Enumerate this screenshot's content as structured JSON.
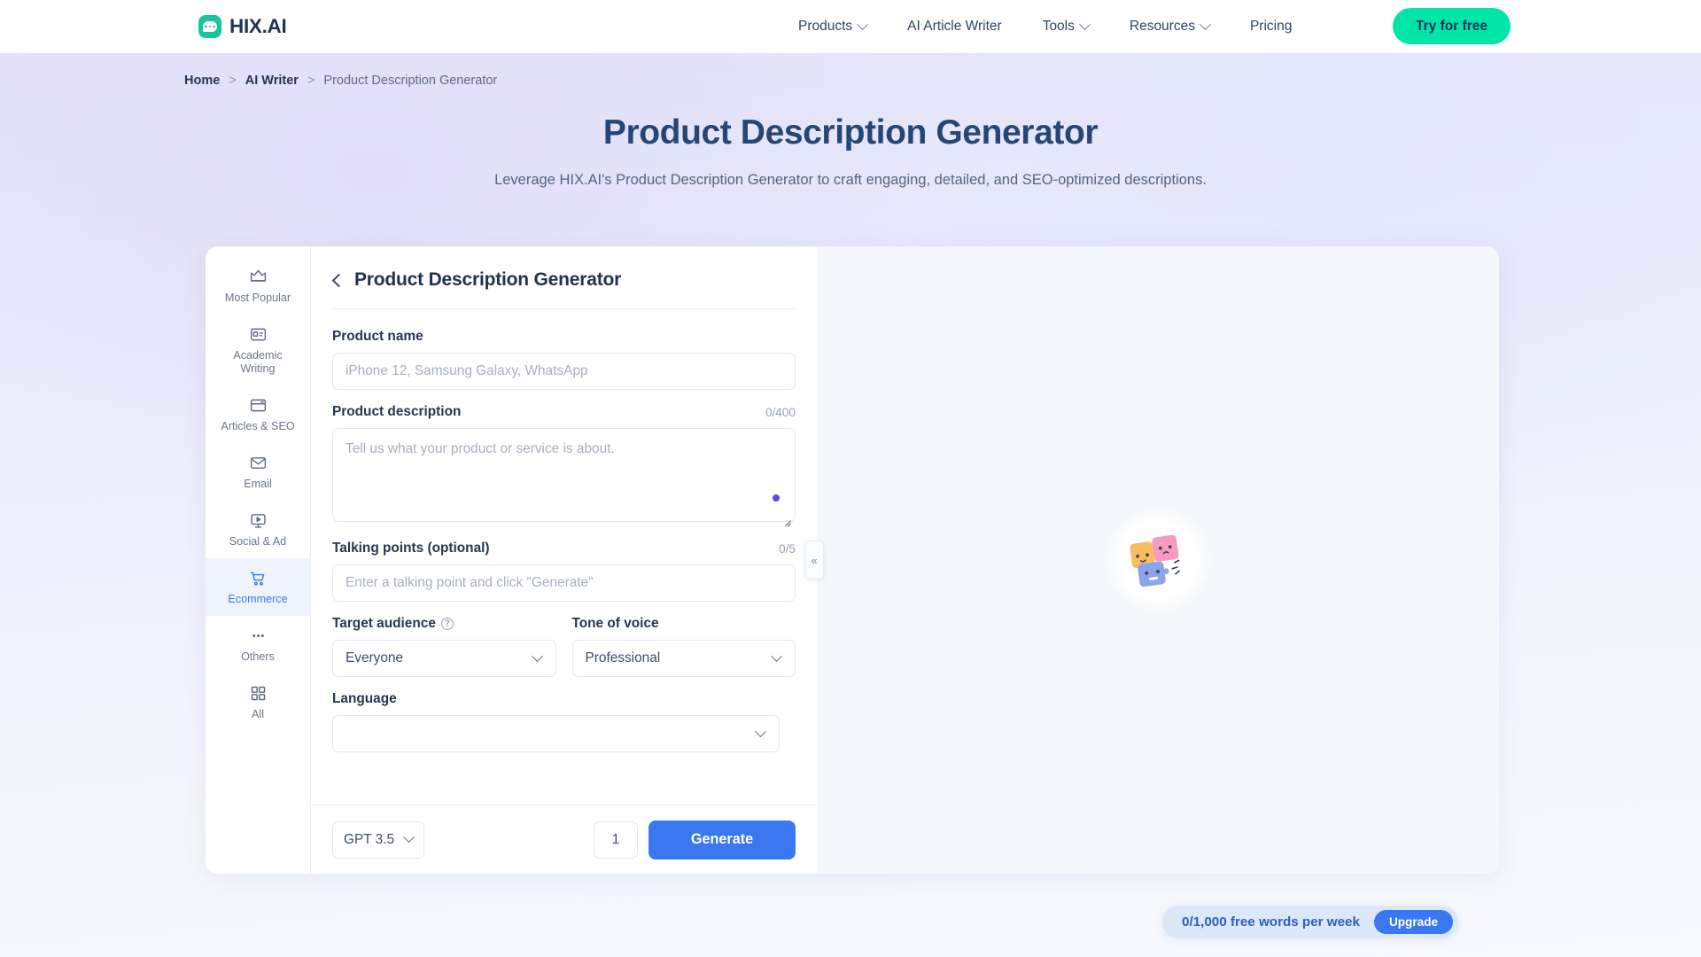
{
  "nav": {
    "brand": "HIX.AI",
    "brand_icon": "chat-bubble-logo-icon",
    "links": [
      {
        "label": "Products",
        "has_caret": true
      },
      {
        "label": "AI Article Writer",
        "has_caret": false
      },
      {
        "label": "Tools",
        "has_caret": true
      },
      {
        "label": "Resources",
        "has_caret": true
      },
      {
        "label": "Pricing",
        "has_caret": false
      }
    ],
    "cta_label": "Try for free",
    "cta_color": "#00e6a8"
  },
  "breadcrumb": {
    "items": [
      "Home",
      "AI Writer",
      "Product Description Generator"
    ],
    "separator": ">"
  },
  "hero": {
    "title": "Product Description Generator",
    "subtitle": "Leverage HIX.AI's Product Description Generator to craft engaging, detailed, and SEO-optimized descriptions."
  },
  "rail": {
    "items": [
      {
        "label": "Most Popular",
        "icon": "crown-icon",
        "active": false
      },
      {
        "label": "Academic Writing",
        "icon": "id-card-icon",
        "active": false
      },
      {
        "label": "Articles & SEO",
        "icon": "browser-window-icon",
        "active": false
      },
      {
        "label": "Email",
        "icon": "envelope-icon",
        "active": false
      },
      {
        "label": "Social & Ad",
        "icon": "monitor-play-icon",
        "active": false
      },
      {
        "label": "Ecommerce",
        "icon": "shopping-cart-icon",
        "active": true
      },
      {
        "label": "Others",
        "icon": "ellipsis-icon",
        "active": false
      },
      {
        "label": "All",
        "icon": "grid-squares-icon",
        "active": false
      }
    ],
    "active_color": "#3478f6"
  },
  "form": {
    "title": "Product Description Generator",
    "back_icon": "chevron-left-icon",
    "product_name": {
      "label": "Product name",
      "placeholder": "iPhone 12, Samsung Galaxy, WhatsApp",
      "value": ""
    },
    "product_description": {
      "label": "Product description",
      "counter": "0/400",
      "placeholder": "Tell us what your product or service is about.",
      "value": ""
    },
    "talking_points": {
      "label": "Talking points (optional)",
      "counter": "0/5",
      "placeholder": "Enter a talking point and click \"Generate\"",
      "value": ""
    },
    "target_audience": {
      "label": "Target audience",
      "help_icon": "question-mark-icon",
      "help_glyph": "?",
      "value": "Everyone"
    },
    "tone_of_voice": {
      "label": "Tone of voice",
      "value": "Professional"
    },
    "language": {
      "label": "Language",
      "value": ""
    }
  },
  "action_bar": {
    "model": "GPT 3.5",
    "quantity": "1",
    "generate_label": "Generate",
    "generate_color": "#3b77f0"
  },
  "output": {
    "collapse_glyph": "«",
    "empty_illustration": "puzzle-pieces-illustration"
  },
  "quota": {
    "text": "0/1,000 free words per week",
    "upgrade_label": "Upgrade"
  }
}
